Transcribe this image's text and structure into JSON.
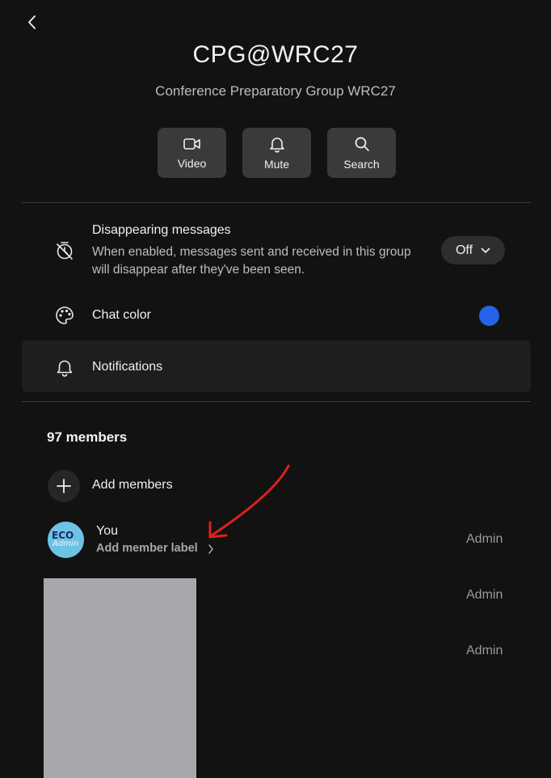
{
  "header": {
    "back_icon": "chevron-left-icon",
    "title": "CPG@WRC27",
    "subtitle": "Conference Preparatory Group WRC27"
  },
  "actions": [
    {
      "label": "Video",
      "icon": "video-camera-icon"
    },
    {
      "label": "Mute",
      "icon": "bell-icon"
    },
    {
      "label": "Search",
      "icon": "search-icon"
    }
  ],
  "settings": {
    "disappearing": {
      "title": "Disappearing messages",
      "description": "When enabled, messages sent and received in this group will disappear after they've been seen.",
      "value": "Off",
      "icon": "timer-off-icon"
    },
    "chat_color": {
      "title": "Chat color",
      "color": "#2563eb",
      "icon": "palette-icon"
    },
    "notifications": {
      "title": "Notifications",
      "icon": "bell-icon"
    }
  },
  "members": {
    "count_label": "97 members",
    "add_label": "Add members",
    "list": [
      {
        "name": "You",
        "sublabel": "Add member label",
        "role": "Admin",
        "avatar_text_1": "ECO",
        "avatar_text_2": "Admin"
      },
      {
        "name": "",
        "role": "Admin"
      },
      {
        "name": "",
        "role": "Admin"
      }
    ]
  },
  "colors": {
    "background": "#121212",
    "button_bg": "#3a3a3a",
    "accent": "#2563eb",
    "annotation": "#e0201b",
    "redaction": "#a7a8ab"
  }
}
